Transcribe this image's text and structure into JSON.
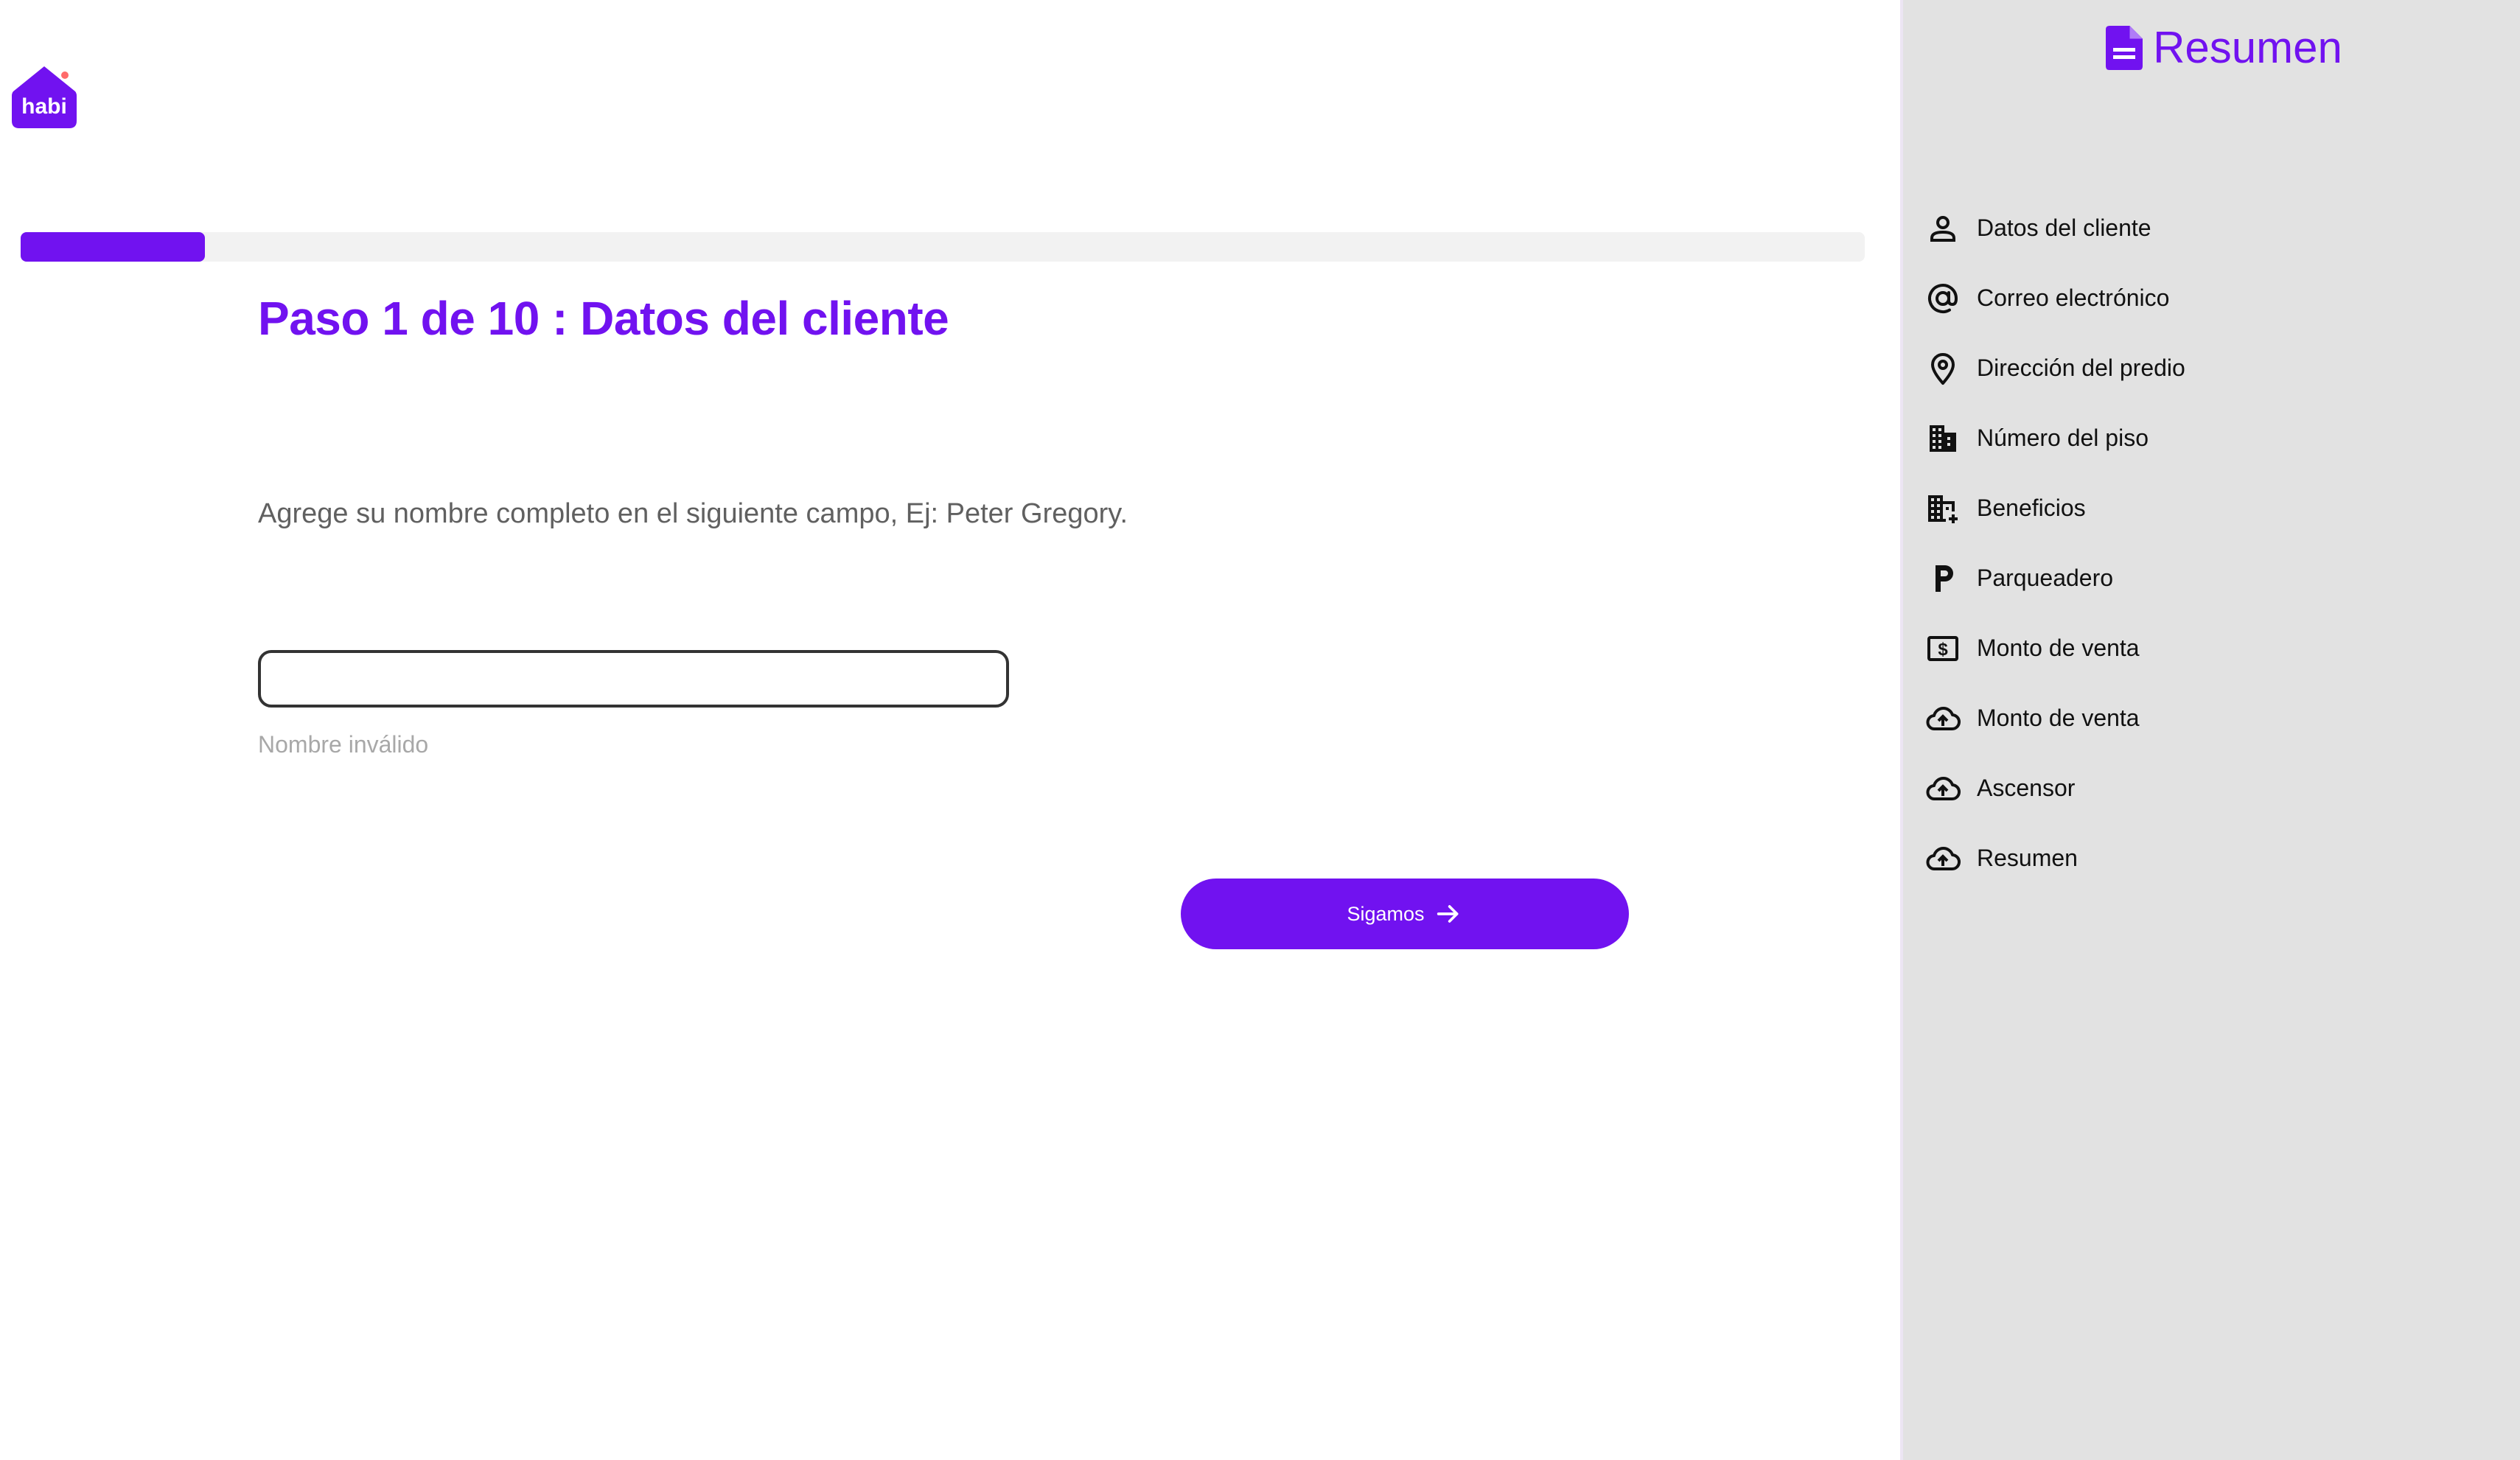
{
  "brand": {
    "logo_text": "habi",
    "accent_color": "#7112f0"
  },
  "progress": {
    "current_step": 1,
    "total_steps": 10,
    "fraction": 0.1
  },
  "step": {
    "title": "Paso 1 de 10 : Datos del cliente",
    "instruction": "Agrege su nombre completo en el siguiente campo, Ej: Peter Gregory."
  },
  "form": {
    "name_value": "",
    "name_placeholder": "",
    "error_text": "Nombre inválido",
    "next_label": "Sigamos",
    "next_icon": "arrow-right-icon"
  },
  "sidebar": {
    "title": "Resumen",
    "title_icon": "document-icon",
    "items": [
      {
        "label": "Datos del cliente",
        "icon": "person-icon"
      },
      {
        "label": "Correo electrónico",
        "icon": "at-sign-icon"
      },
      {
        "label": "Dirección del predio",
        "icon": "location-pin-icon"
      },
      {
        "label": "Número del piso",
        "icon": "building-icon"
      },
      {
        "label": "Beneficios",
        "icon": "building-plus-icon"
      },
      {
        "label": "Parqueadero",
        "icon": "parking-icon"
      },
      {
        "label": "Monto de venta",
        "icon": "money-icon"
      },
      {
        "label": "Monto de venta",
        "icon": "cloud-upload-icon"
      },
      {
        "label": "Ascensor",
        "icon": "cloud-upload-icon"
      },
      {
        "label": "Resumen",
        "icon": "cloud-upload-icon"
      }
    ]
  }
}
